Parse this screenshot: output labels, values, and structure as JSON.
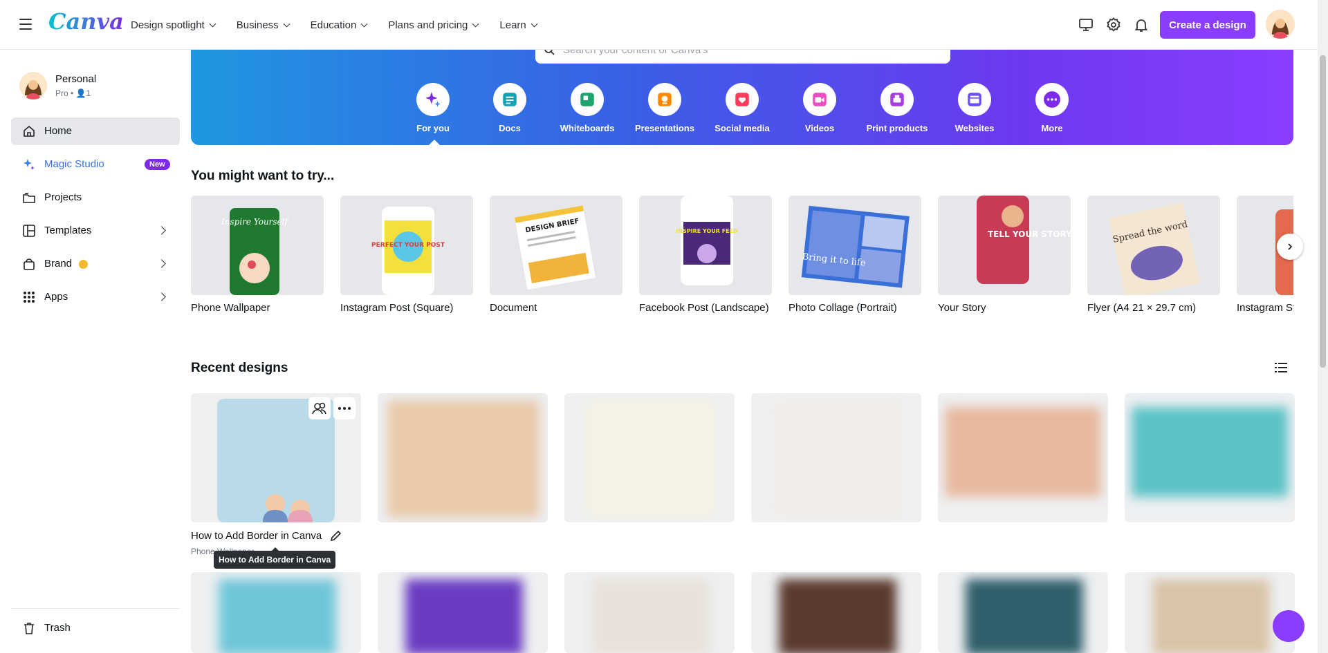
{
  "nav": {
    "logo": "Canva",
    "items": [
      "Design spotlight",
      "Business",
      "Education",
      "Plans and pricing",
      "Learn"
    ],
    "create_label": "Create a design"
  },
  "sidebar": {
    "account_name": "Personal",
    "account_sub": "Pro • 👤1",
    "items": [
      {
        "label": "Home",
        "icon": "home-icon"
      },
      {
        "label": "Magic Studio",
        "icon": "sparkle-icon",
        "badge": "New"
      },
      {
        "label": "Projects",
        "icon": "folder-icon"
      },
      {
        "label": "Templates",
        "icon": "template-icon"
      },
      {
        "label": "Brand",
        "icon": "brand-icon"
      },
      {
        "label": "Apps",
        "icon": "apps-icon"
      }
    ],
    "trash_label": "Trash"
  },
  "hero": {
    "search_placeholder": "Search your content or Canva's",
    "categories": [
      {
        "label": "For you",
        "color": "#7d2ae8"
      },
      {
        "label": "Docs",
        "color": "#13a3b5"
      },
      {
        "label": "Whiteboards",
        "color": "#1ea36c"
      },
      {
        "label": "Presentations",
        "color": "#ff8a00"
      },
      {
        "label": "Social media",
        "color": "#ff3b5c"
      },
      {
        "label": "Videos",
        "color": "#e94fc1"
      },
      {
        "label": "Print products",
        "color": "#a63dde"
      },
      {
        "label": "Websites",
        "color": "#6a4fff"
      },
      {
        "label": "More",
        "color": "#7d2ae8"
      }
    ]
  },
  "try": {
    "title": "You might want to try...",
    "items": [
      {
        "label": "Phone Wallpaper",
        "thumb_text": "Inspire Yourself"
      },
      {
        "label": "Instagram Post (Square)",
        "thumb_text": "PERFECT YOUR POST"
      },
      {
        "label": "Document",
        "thumb_text": "DESIGN BRIEF"
      },
      {
        "label": "Facebook Post (Landscape)",
        "thumb_text": "INSPIRE YOUR FEED"
      },
      {
        "label": "Photo Collage (Portrait)",
        "thumb_text": "Bring it to life"
      },
      {
        "label": "Your Story",
        "thumb_text": "TELL YOUR STORY"
      },
      {
        "label": "Flyer (A4 21 × 29.7 cm)",
        "thumb_text": "Spread the word"
      },
      {
        "label": "Instagram St",
        "thumb_text": ""
      }
    ]
  },
  "recent": {
    "title": "Recent designs",
    "first_title": "How to Add Border in Canva",
    "first_sub": "Phone Wallpaper",
    "tooltip": "How to Add Border in Canva",
    "colors": [
      "#cfe3ee",
      "#e9c9a9",
      "#f4f2e4",
      "#f1eeea",
      "#e8b89e",
      "#5bc2c6"
    ]
  }
}
